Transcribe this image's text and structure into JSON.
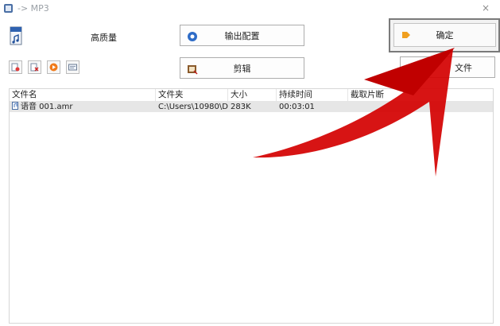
{
  "window": {
    "title": "-> MP3",
    "close_glyph": "×"
  },
  "format": {
    "icon": "mp3-file-icon",
    "quality": "高质量"
  },
  "buttons": {
    "output": "输出配置",
    "edit": "剪辑",
    "ok": "确定",
    "add_file": "文件"
  },
  "toolbar_icons": [
    "add-file-icon",
    "remove-file-icon",
    "play-icon",
    "info-icon"
  ],
  "table": {
    "columns": [
      "文件名",
      "文件夹",
      "大小",
      "持续时间",
      "截取片断"
    ],
    "rows": [
      {
        "name": "语音 001.amr",
        "folder": "C:\\Users\\10980\\De...",
        "size": "283K",
        "duration": "00:03:01",
        "clip": ""
      }
    ]
  },
  "colors": {
    "arrow": "#d40000",
    "accent_orange": "#f0a020"
  }
}
